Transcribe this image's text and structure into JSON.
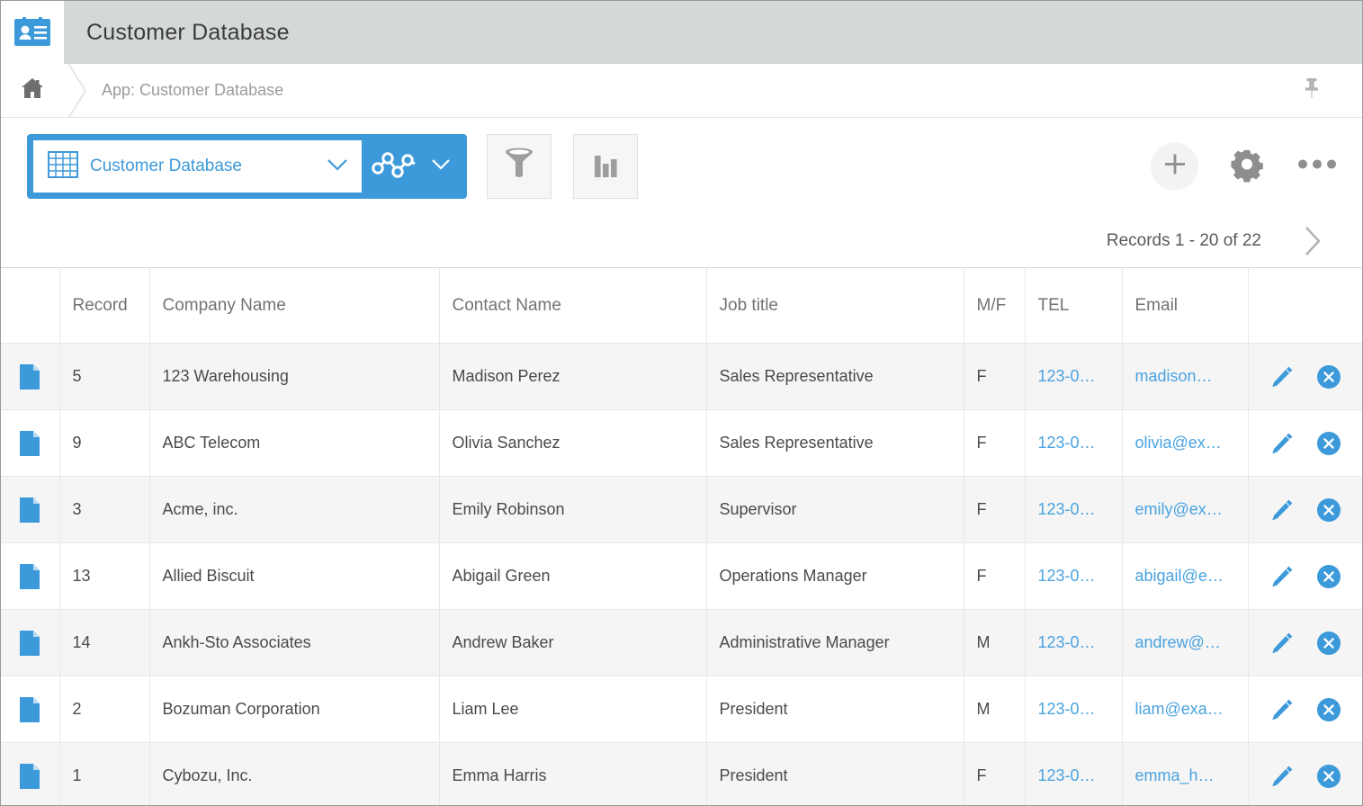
{
  "titlebar": {
    "app_icon": "contact-card-icon",
    "title": "Customer Database"
  },
  "breadcrumb": {
    "home_icon": "home-icon",
    "path": "App: Customer Database",
    "pin_icon": "pin-icon"
  },
  "toolbar": {
    "view_icon": "table-grid-icon",
    "view_label": "Customer Database",
    "view_chevron_icon": "chevron-down-icon",
    "graph_icon": "line-graph-icon",
    "graph_chevron_icon": "chevron-down-icon",
    "filter_icon": "funnel-filter-icon",
    "chart_icon": "bar-chart-icon",
    "add_icon": "plus-icon",
    "settings_icon": "gear-icon",
    "more_icon": "ellipsis-icon"
  },
  "pager": {
    "label": "Records 1 - 20 of 22",
    "next_icon": "chevron-right-icon"
  },
  "table": {
    "columns": [
      {
        "key": "flag",
        "label": ""
      },
      {
        "key": "record",
        "label": "Record"
      },
      {
        "key": "company",
        "label": "Company Name"
      },
      {
        "key": "contact",
        "label": "Contact Name"
      },
      {
        "key": "job",
        "label": "Job title"
      },
      {
        "key": "mf",
        "label": "M/F"
      },
      {
        "key": "tel",
        "label": "TEL"
      },
      {
        "key": "email",
        "label": "Email"
      },
      {
        "key": "actions",
        "label": ""
      }
    ],
    "row_icon": "document-icon",
    "edit_icon": "pencil-edit-icon",
    "delete_icon": "delete-x-icon",
    "rows": [
      {
        "record": "5",
        "company": "123 Warehousing",
        "contact": "Madison Perez",
        "job": "Sales Representative",
        "mf": "F",
        "tel": "123-0…",
        "email": "madison…"
      },
      {
        "record": "9",
        "company": "ABC Telecom",
        "contact": "Olivia Sanchez",
        "job": "Sales Representative",
        "mf": "F",
        "tel": "123-0…",
        "email": "olivia@ex…"
      },
      {
        "record": "3",
        "company": "Acme, inc.",
        "contact": "Emily Robinson",
        "job": "Supervisor",
        "mf": "F",
        "tel": "123-0…",
        "email": "emily@ex…"
      },
      {
        "record": "13",
        "company": "Allied Biscuit",
        "contact": "Abigail Green",
        "job": "Operations Manager",
        "mf": "F",
        "tel": "123-0…",
        "email": "abigail@e…"
      },
      {
        "record": "14",
        "company": "Ankh-Sto Associates",
        "contact": "Andrew Baker",
        "job": "Administrative Manager",
        "mf": "M",
        "tel": "123-0…",
        "email": "andrew@…"
      },
      {
        "record": "2",
        "company": "Bozuman Corporation",
        "contact": "Liam Lee",
        "job": "President",
        "mf": "M",
        "tel": "123-0…",
        "email": "liam@exa…"
      },
      {
        "record": "1",
        "company": "Cybozu, Inc.",
        "contact": "Emma Harris",
        "job": "President",
        "mf": "F",
        "tel": "123-0…",
        "email": "emma_h…"
      }
    ]
  },
  "colors": {
    "accent_blue": "#3d9ada",
    "link_blue": "#4aa3e0",
    "titlebar_gray": "#d5d8d8",
    "row_stripe": "#f5f5f5",
    "icon_gray": "#9b9b9b"
  }
}
